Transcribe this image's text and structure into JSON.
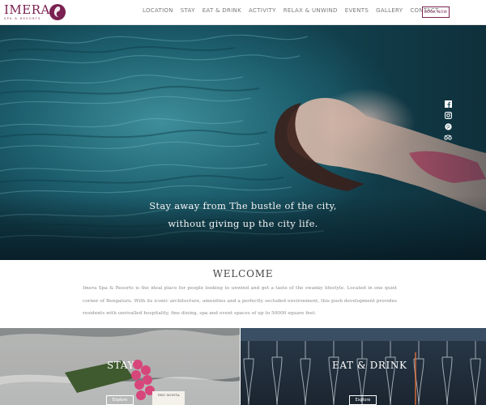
{
  "header": {
    "logo_text": "IMERA",
    "logo_sub": "SPA & RESORTS",
    "nav": [
      "LOCATION",
      "STAY",
      "EAT & DRINK",
      "ACTIVITY",
      "RELAX & UNWIND",
      "EVENTS",
      "GALLERY",
      "CONTACT"
    ],
    "book_label": "BOOK NOW"
  },
  "hero": {
    "line1": "Stay away from The bustle of the city,",
    "line2": "without giving up the city life.",
    "social_icons": [
      "facebook-icon",
      "instagram-icon",
      "pinterest-icon",
      "tripadvisor-icon"
    ]
  },
  "welcome": {
    "title": "WELCOME",
    "body": "Imera Spa & Resorts is the ideal place for people looking to unwind and get a taste of the swanky lifestyle. Located in one quiet corner of Bengaluru. With its iconic architecture, amenities and a perfectly secluded environment, this posh development provides residents with unrivalled hospitality, fine dining, spa and event spaces of up to 50000 square feet."
  },
  "panels": {
    "stay_title": "STAY",
    "eat_title": "EAT & DRINK",
    "explore_label": "Explore",
    "book_caption": "ERO MONTA"
  },
  "colors": {
    "brand": "#7a2151",
    "water": "#2a7383"
  }
}
